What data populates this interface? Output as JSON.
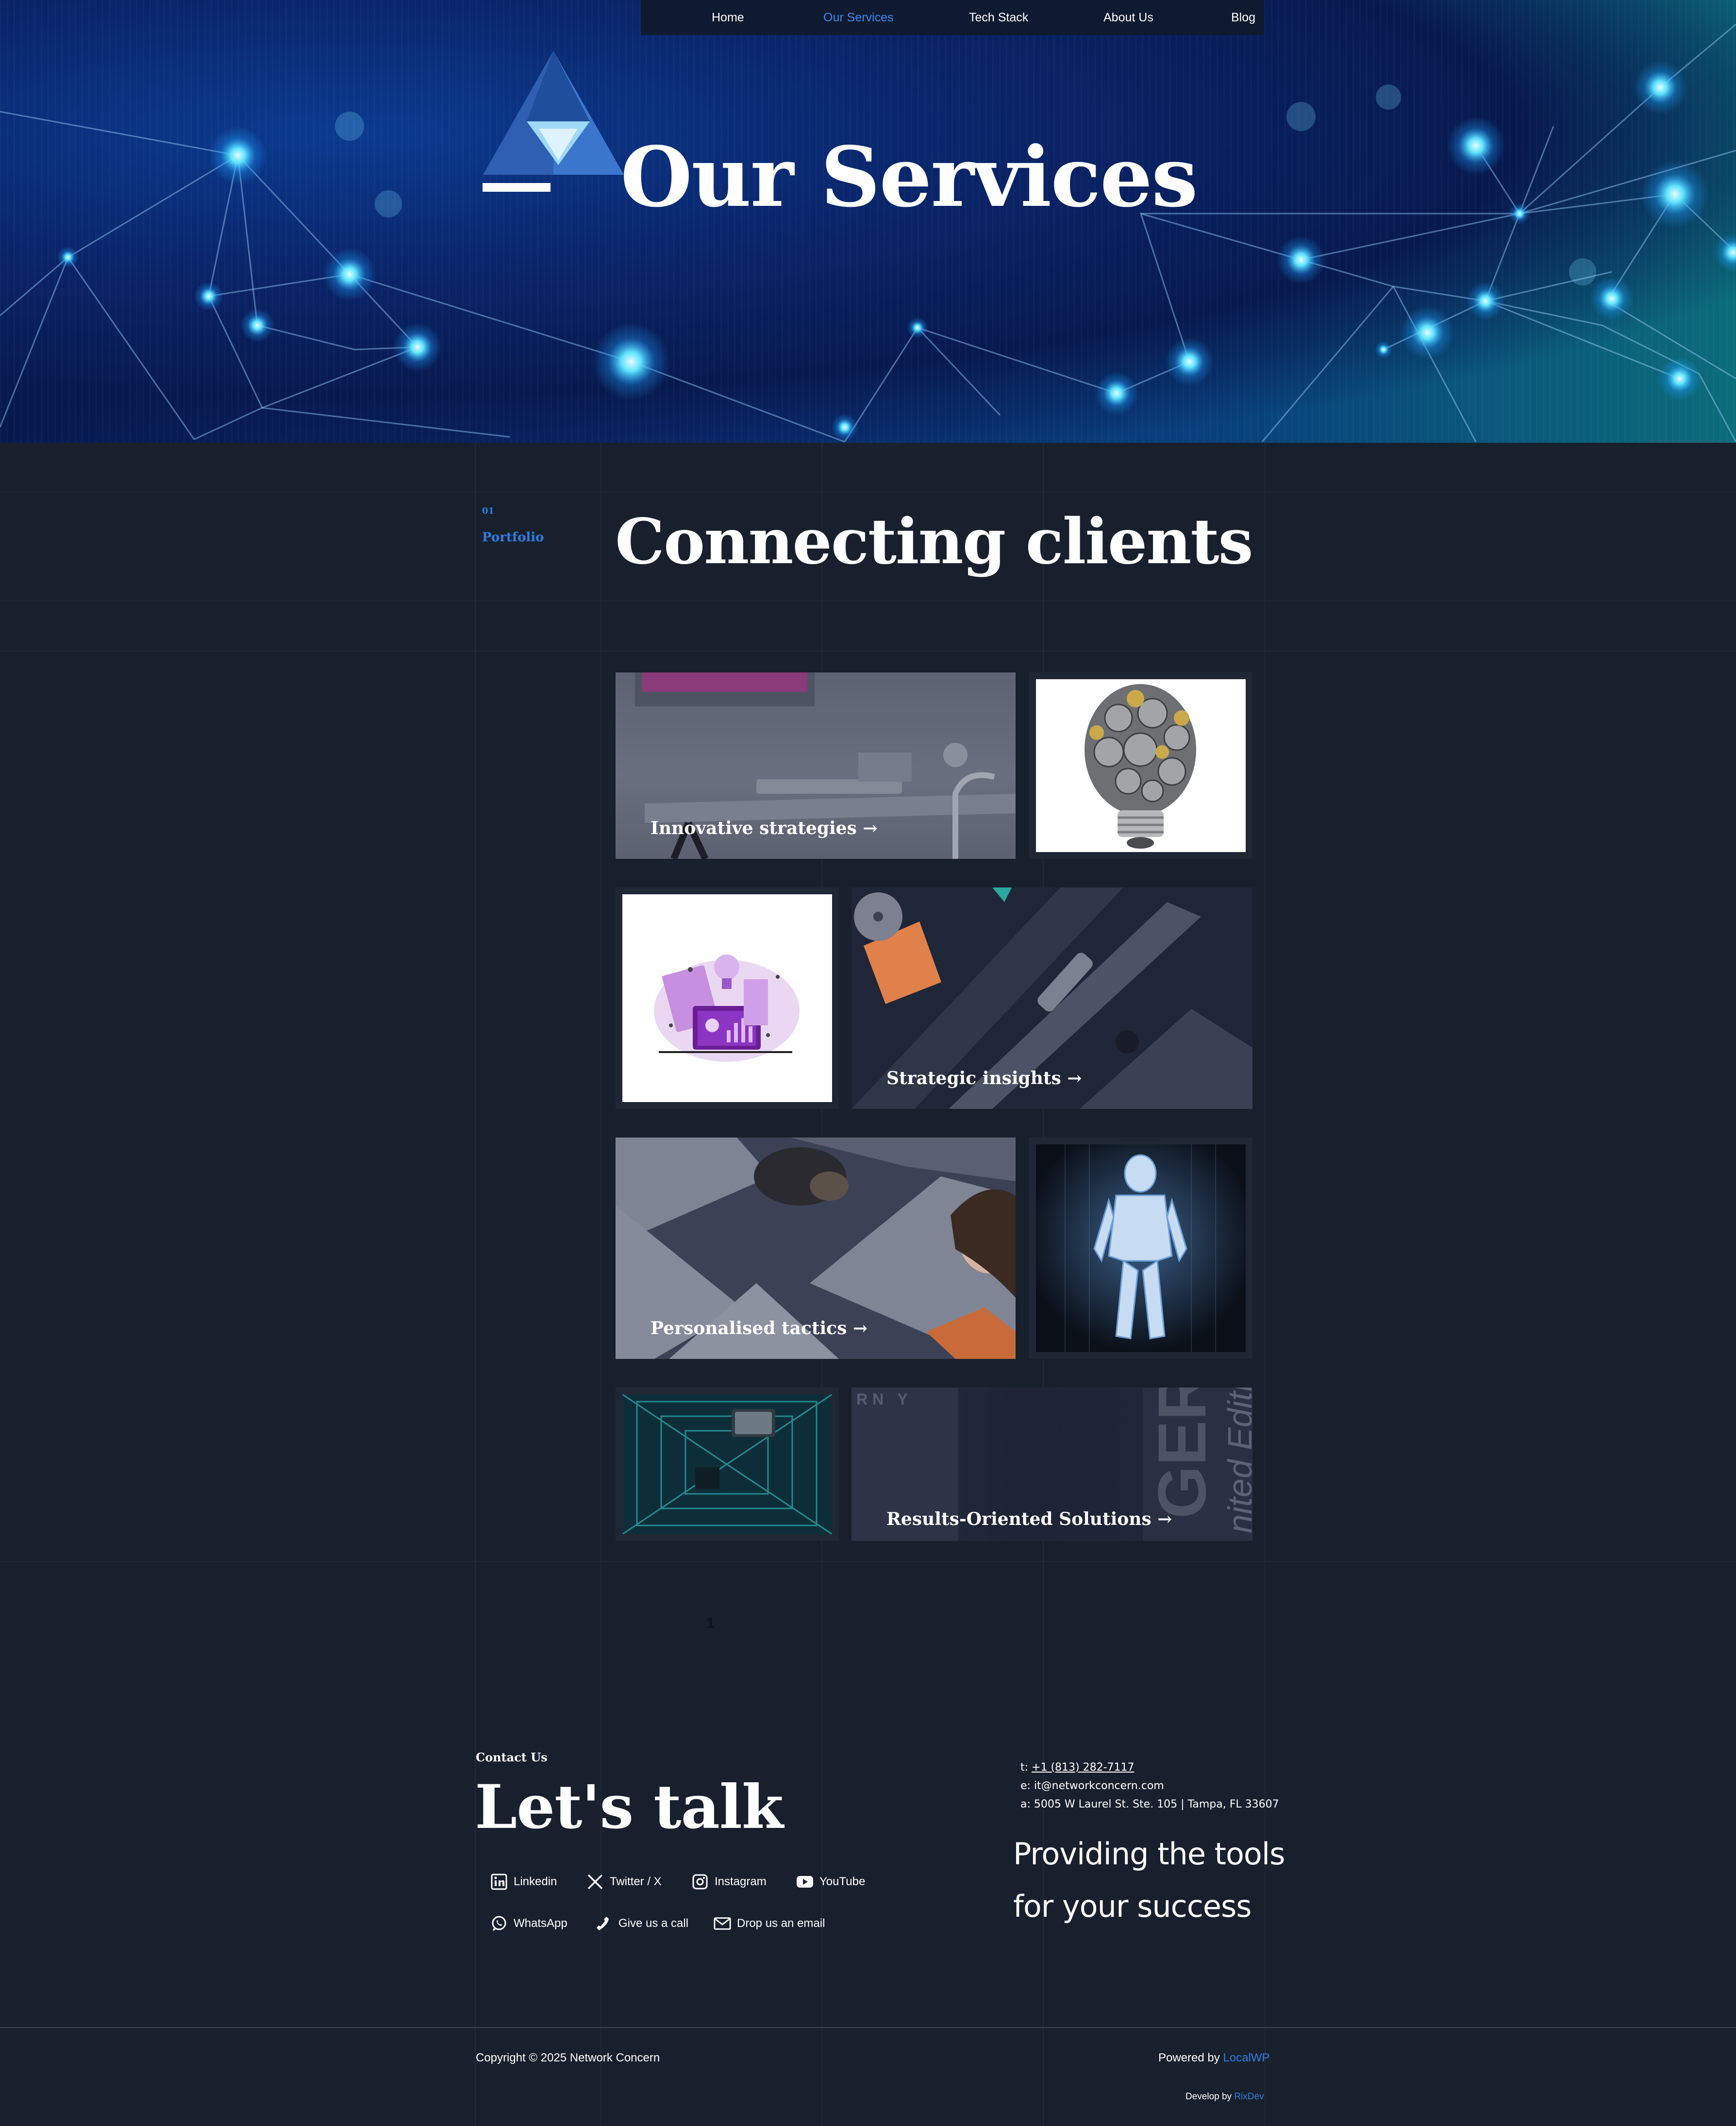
{
  "nav": {
    "items": [
      {
        "label": "Home",
        "active": false
      },
      {
        "label": "Our Services",
        "active": true
      },
      {
        "label": "Tech Stack",
        "active": false
      },
      {
        "label": "About Us",
        "active": false
      },
      {
        "label": "Blog",
        "active": false
      }
    ]
  },
  "hero": {
    "title": "Our Services"
  },
  "intro": {
    "index": "01",
    "portfolio_label": "Portfolio",
    "title": "Connecting clients"
  },
  "gallery": {
    "captions": {
      "innovative": "Innovative strategies →",
      "strategic": "Strategic insights →",
      "personalised": "Personalised tactics →",
      "results": "Results-Oriented Solutions →"
    },
    "image_text": {
      "gears_sign": "RN Y",
      "ger_word": "GER",
      "edition": "nited Edition"
    }
  },
  "pagination": {
    "current": "1"
  },
  "contact": {
    "eyebrow": "Contact Us",
    "title": "Let's talk",
    "socials": {
      "linkedin": "Linkedin",
      "twitter": "Twitter / X",
      "instagram": "Instagram",
      "youtube": "YouTube",
      "whatsapp": "WhatsApp",
      "call": "Give us a call",
      "email": "Drop us an email"
    },
    "phone_prefix": "t: ",
    "phone": "+1 (813) 282-7117",
    "email_line": "e: it@networkconcern.com",
    "address_line": "a: 5005 W Laurel St. Ste. 105 | Tampa, FL 33607",
    "tagline_1": "Providing the tools",
    "tagline_2": "for your success"
  },
  "footer": {
    "copyright": "Copyright © 2025 Network Concern",
    "powered_prefix": "Powered by ",
    "powered_link": "LocalWP",
    "dev_prefix": "Develop by ",
    "dev_link": "RixDev"
  },
  "colors": {
    "accent": "#2f7de0",
    "background": "#19202d",
    "nav_bg": "#0f1a30"
  }
}
